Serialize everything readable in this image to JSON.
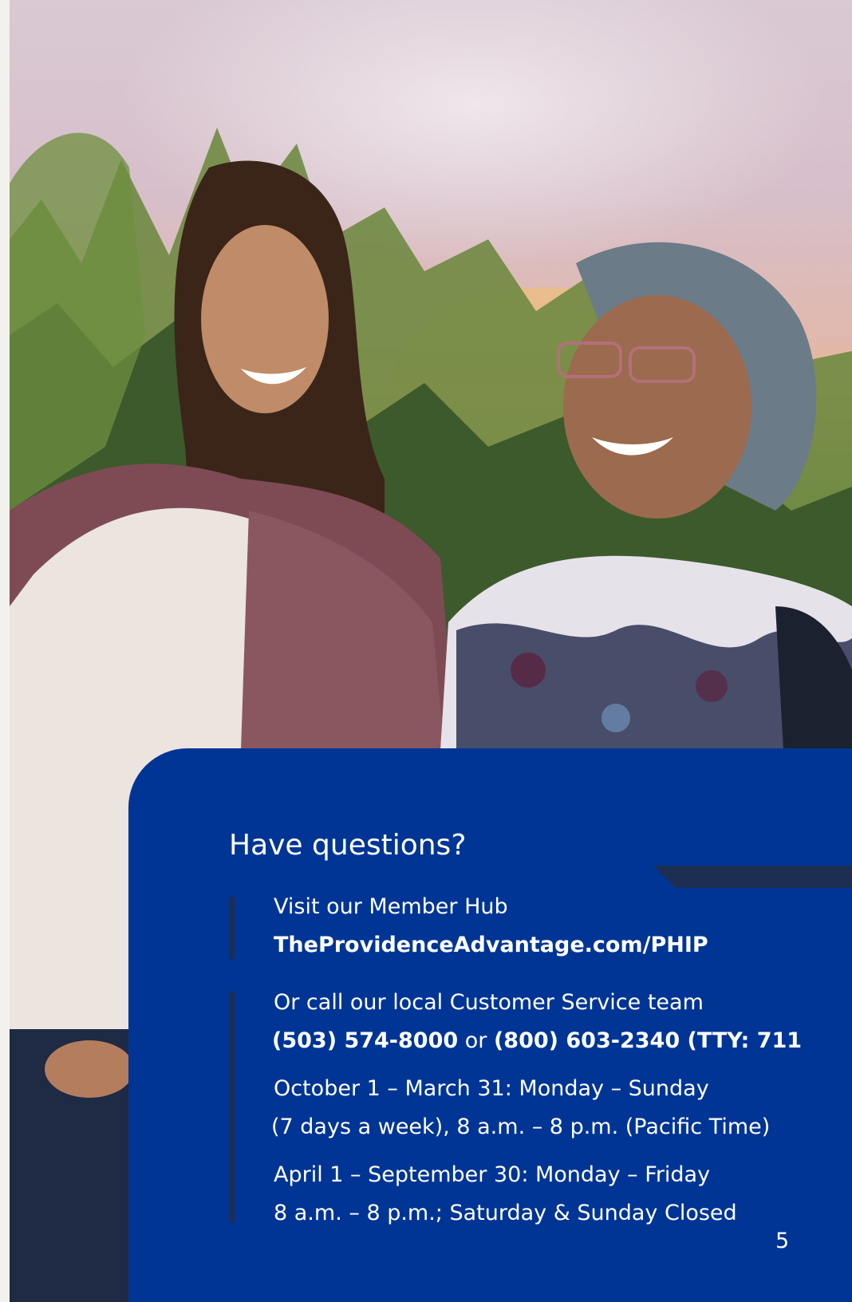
{
  "panel": {
    "heading": "Have questions?",
    "member_hub": {
      "intro": "Visit our Member Hub",
      "link": "TheProvidenceAdvantage.com/PHIP"
    },
    "customer_service": {
      "intro": "Or call our local Customer Service team",
      "phone_primary": "(503) 574-8000",
      "connector": " or ",
      "phone_secondary": "(800) 603-2340 (TTY: 711",
      "hours_season_1_line_1": "October 1 – March 31: Monday – Sunday",
      "hours_season_1_line_2": "(7 days a week), 8 a.m. – 8 p.m. (Pacific Time)",
      "hours_season_2_line_1": "April 1 – September 30: Monday – Friday",
      "hours_season_2_line_2": "8 a.m. – 8 p.m.; Saturday & Sunday Closed"
    }
  },
  "page_number": "5",
  "colors": {
    "panel_blue": "#003595",
    "accent_navy": "#1c2e52",
    "text": "#ffffff"
  }
}
